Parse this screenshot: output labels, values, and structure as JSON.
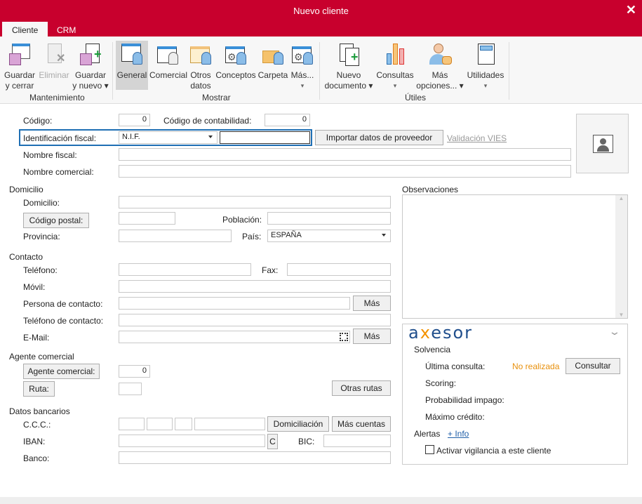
{
  "window": {
    "title": "Nuevo cliente",
    "close": "✕"
  },
  "tabs": [
    {
      "label": "Cliente",
      "active": true
    },
    {
      "label": "CRM",
      "active": false
    }
  ],
  "ribbon": {
    "groups": {
      "mantenimiento": "Mantenimiento",
      "mostrar": "Mostrar",
      "utiles": "Útiles"
    },
    "buttons": {
      "guardar_cerrar": [
        "Guardar",
        "y cerrar"
      ],
      "eliminar": [
        "Eliminar",
        ""
      ],
      "guardar_nuevo": [
        "Guardar",
        "y nuevo ▾"
      ],
      "general": [
        "General",
        ""
      ],
      "comercial": [
        "Comercial",
        ""
      ],
      "otros_datos": [
        "Otros",
        "datos"
      ],
      "conceptos": [
        "Conceptos",
        ""
      ],
      "carpeta": [
        "Carpeta",
        ""
      ],
      "mas": [
        "Más...",
        "▾"
      ],
      "nuevo_documento": [
        "Nuevo",
        "documento ▾"
      ],
      "consultas": [
        "Consultas",
        "▾"
      ],
      "mas_opciones": [
        "Más",
        "opciones... ▾"
      ],
      "utilidades": [
        "Utilidades",
        "▾"
      ]
    }
  },
  "form": {
    "codigo": {
      "label": "Código:",
      "value": "0"
    },
    "codigo_contabilidad": {
      "label": "Código de contabilidad:",
      "value": "0"
    },
    "identificacion": {
      "label": "Identificación fiscal:",
      "type": "N.I.F.",
      "value": ""
    },
    "importar": "Importar datos de proveedor",
    "validacion": "Validación VIES",
    "nombre_fiscal": {
      "label": "Nombre fiscal:",
      "value": ""
    },
    "nombre_comercial": {
      "label": "Nombre comercial:",
      "value": ""
    },
    "sec_domicilio": "Domicilio",
    "domicilio": {
      "label": "Domicilio:",
      "value": ""
    },
    "codigo_postal": {
      "label": "Código postal:",
      "value": ""
    },
    "poblacion": {
      "label": "Población:",
      "value": ""
    },
    "provincia": {
      "label": "Provincia:",
      "value": ""
    },
    "pais": {
      "label": "País:",
      "value": "ESPAÑA"
    },
    "sec_contacto": "Contacto",
    "telefono": {
      "label": "Teléfono:",
      "value": ""
    },
    "fax": {
      "label": "Fax:",
      "value": ""
    },
    "movil": {
      "label": "Móvil:",
      "value": ""
    },
    "persona_contacto": {
      "label": "Persona de contacto:",
      "value": "",
      "mas": "Más"
    },
    "telefono_contacto": {
      "label": "Teléfono de contacto:",
      "value": ""
    },
    "email": {
      "label": "E-Mail:",
      "value": "",
      "mas": "Más"
    },
    "sec_agente": "Agente comercial",
    "agente": {
      "label": "Agente comercial:",
      "value": "0"
    },
    "ruta": {
      "label": "Ruta:",
      "value": "",
      "otras": "Otras rutas"
    },
    "sec_bancarios": "Datos bancarios",
    "ccc": {
      "label": "C.C.C.:",
      "domiciliacion": "Domiciliación",
      "mas_cuentas": "Más cuentas"
    },
    "iban": {
      "label": "IBAN:",
      "c": "C"
    },
    "bic": {
      "label": "BIC:",
      "value": ""
    },
    "banco": {
      "label": "Banco:",
      "value": ""
    },
    "observaciones": {
      "label": "Observaciones",
      "value": ""
    }
  },
  "axesor": {
    "logo": "axesor",
    "solvencia": "Solvencia",
    "ultima_consulta": "Última consulta:",
    "ultima_value": "No realizada",
    "consultar": "Consultar",
    "scoring": "Scoring:",
    "probabilidad": "Probabilidad impago:",
    "maximo": "Máximo crédito:",
    "alertas": "Alertas",
    "info": "+ Info",
    "vigilancia": "Activar vigilancia a este cliente",
    "vigilancia_checked": false,
    "colors": {
      "brand_blue": "#1f4e8c",
      "brand_orange": "#f39200",
      "status": "#e8900c"
    }
  },
  "colors": {
    "titlebar": "#c8002d",
    "focus": "#1f6fb4"
  }
}
